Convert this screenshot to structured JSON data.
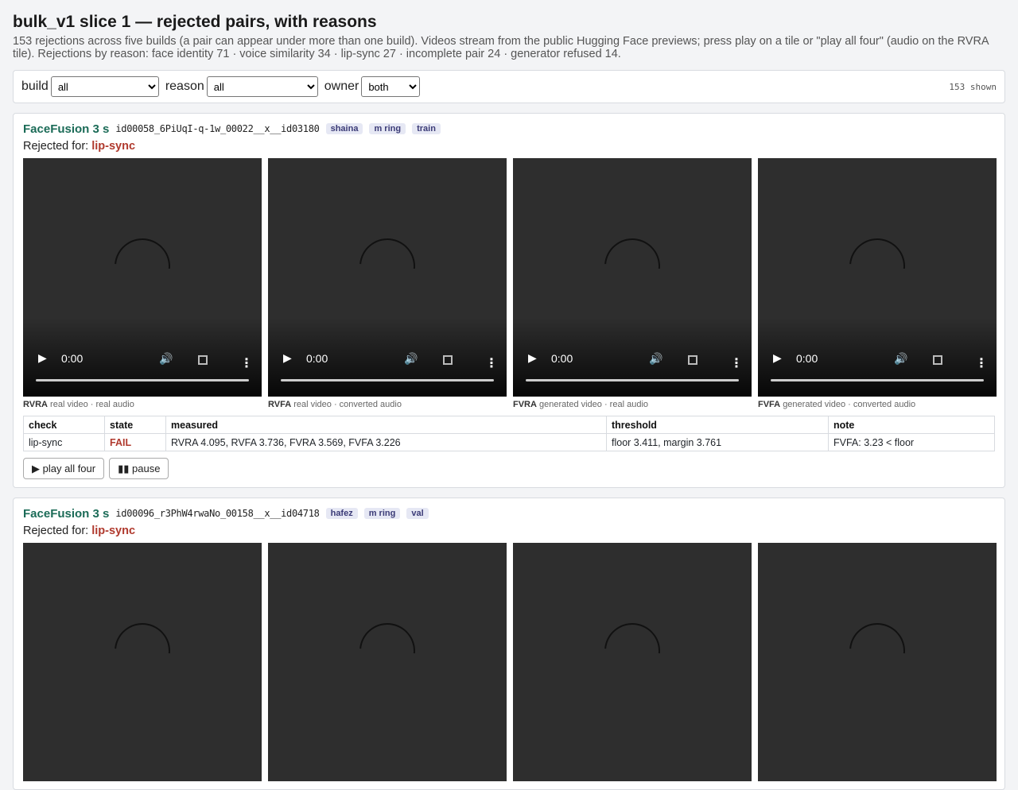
{
  "page": {
    "title": "bulk_v1 slice 1 — rejected pairs, with reasons",
    "intro": "153 rejections across five builds (a pair can appear under more than one build). Videos stream from the public Hugging Face previews; press play on a tile or \"play all four\" (audio on the RVRA tile). Rejections by reason: face identity 71 · voice similarity 34 · lip-sync 27 · incomplete pair 24 · generator refused 14."
  },
  "filters": {
    "build_label": "build",
    "build_value": "all",
    "reason_label": "reason",
    "reason_value": "all",
    "owner_label": "owner",
    "owner_value": "both",
    "shown": "153 shown"
  },
  "video_controls": {
    "time": "0:00",
    "play_glyph": "▶",
    "mute_glyph": "🔊",
    "more_glyph": "⋮"
  },
  "cards": [
    {
      "build": "FaceFusion 3 s",
      "pair_id": "id00058_6PiUqI-q-1w_00022__x__id03180",
      "tags": [
        "shaina",
        "m ring",
        "train"
      ],
      "rejected_prefix": "Rejected for:",
      "reason": "lip-sync",
      "tiles": [
        {
          "code": "RVRA",
          "desc": "real video · real audio"
        },
        {
          "code": "RVFA",
          "desc": "real video · converted audio"
        },
        {
          "code": "FVRA",
          "desc": "generated video · real audio"
        },
        {
          "code": "FVFA",
          "desc": "generated video · converted audio"
        }
      ],
      "table": {
        "headers": [
          "check",
          "state",
          "measured",
          "threshold",
          "note"
        ],
        "rows": [
          {
            "check": "lip-sync",
            "state": "FAIL",
            "measured": "RVRA 4.095, RVFA 3.736, FVRA 3.569, FVFA 3.226",
            "threshold": "floor 3.411, margin 3.761",
            "note": "FVFA: 3.23 < floor"
          }
        ]
      },
      "play_all_label": "▶ play all four",
      "pause_label": "▮▮ pause"
    },
    {
      "build": "FaceFusion 3 s",
      "pair_id": "id00096_r3PhW4rwaNo_00158__x__id04718",
      "tags": [
        "hafez",
        "m ring",
        "val"
      ],
      "rejected_prefix": "Rejected for:",
      "reason": "lip-sync"
    }
  ],
  "colors": {
    "build": "#1b6b57",
    "reason": "#b03a2e",
    "fail": "#b03a2e",
    "tag_bg": "#e6e8f4",
    "tag_text": "#3b3b77",
    "video_bg": "#2e2e2e"
  },
  "icons": [
    "play-icon",
    "volume-icon",
    "fullscreen-icon",
    "more-options-icon",
    "loading-spinner-icon"
  ]
}
